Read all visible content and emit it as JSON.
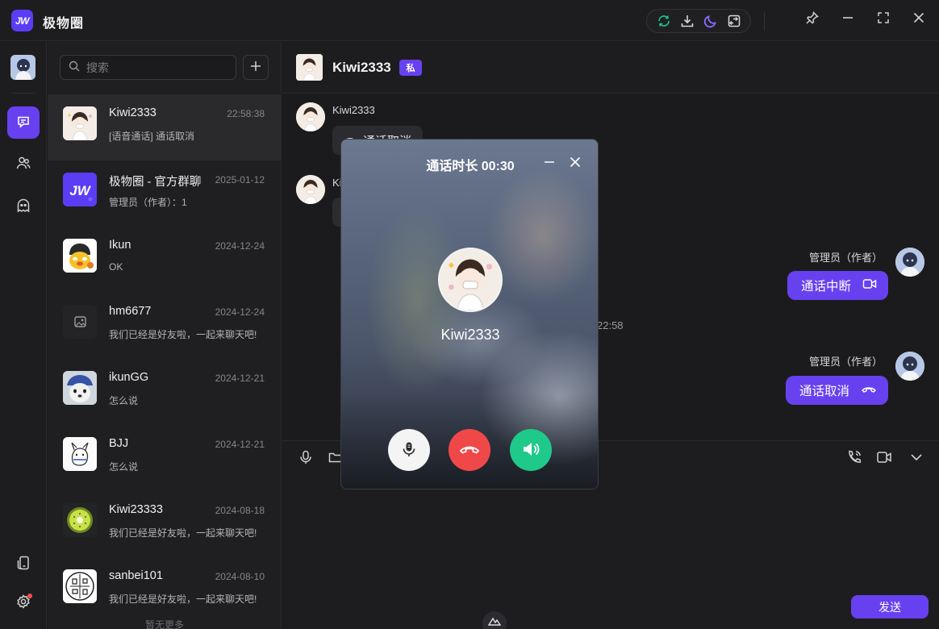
{
  "app": {
    "logo_text": "JW",
    "title": "极物圈"
  },
  "titlebar_icons": [
    "sync-icon",
    "download-icon",
    "moon-icon",
    "window-switch-icon",
    "pin-icon",
    "minimize-icon",
    "maximize-icon",
    "close-icon"
  ],
  "search": {
    "placeholder": "搜索"
  },
  "conversations": [
    {
      "name": "Kiwi2333",
      "time": "22:58:38",
      "message": "[语音通话] 通话取消"
    },
    {
      "name": "极物圈 - 官方群聊",
      "time": "2025-01-12",
      "message": "管理员（作者）：1"
    },
    {
      "name": "Ikun",
      "time": "2024-12-24",
      "message": "OK"
    },
    {
      "name": "hm6677",
      "time": "2024-12-24",
      "message": "我们已经是好友啦，一起来聊天吧!"
    },
    {
      "name": "ikunGG",
      "time": "2024-12-21",
      "message": "怎么说"
    },
    {
      "name": "BJJ",
      "time": "2024-12-21",
      "message": "怎么说"
    },
    {
      "name": "Kiwi23333",
      "time": "2024-08-18",
      "message": "我们已经是好友啦，一起来聊天吧!"
    },
    {
      "name": "sanbei101",
      "time": "2024-08-10",
      "message": "我们已经是好友啦，一起来聊天吧!"
    }
  ],
  "list_footer": "暂无更多",
  "chat": {
    "title": "Kiwi2333",
    "badge": "私",
    "messages": {
      "m1_sender": "Kiwi2333",
      "m1_text": "通话取消",
      "m2_sender": "Kiwi2333",
      "m3_sender": "管理员（作者）",
      "m3_text": "通话中断",
      "timestamp": "22:58",
      "m4_sender": "管理员（作者）",
      "m4_text": "通话取消"
    },
    "send_label": "发送"
  },
  "call": {
    "title": "通话时长 00:30",
    "name": "Kiwi2333"
  },
  "colors": {
    "accent": "#6741f0",
    "hangup": "#f04848",
    "speaker": "#1ec98a"
  }
}
